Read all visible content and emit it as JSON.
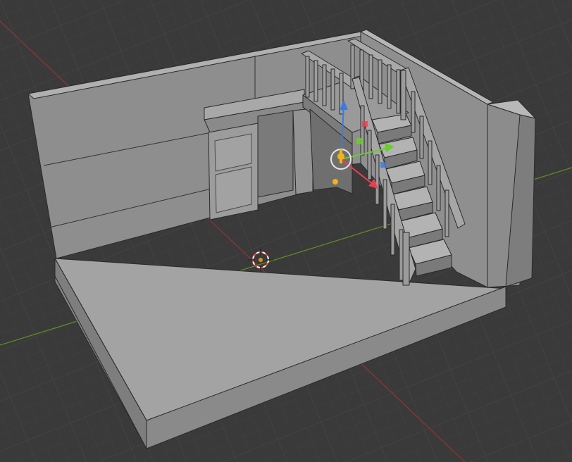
{
  "viewport": {
    "mode": "3D Viewport",
    "shading": "solid",
    "background": "#3a3a3a",
    "grid_color": "#4a4a4a",
    "grid_minor_color": "#404040",
    "axis_x_color": "#a33a3a",
    "axis_y_color": "#6b9a2a"
  },
  "scene": {
    "model": "room-with-staircase",
    "surface_color": "#9b9b9b",
    "floor_color": "#a4a4a4",
    "edge_color": "#2b2b2b"
  },
  "gizmo": {
    "x_color": "#e8404f",
    "y_color": "#6dcb2b",
    "z_color": "#3e7bd8",
    "pivot_color": "#f0b419",
    "ring_color": "#e6e6e6"
  },
  "cursor_3d": {
    "ring_colors": [
      "#ff4040",
      "#ffffff"
    ],
    "center_color": "#e08a28"
  }
}
